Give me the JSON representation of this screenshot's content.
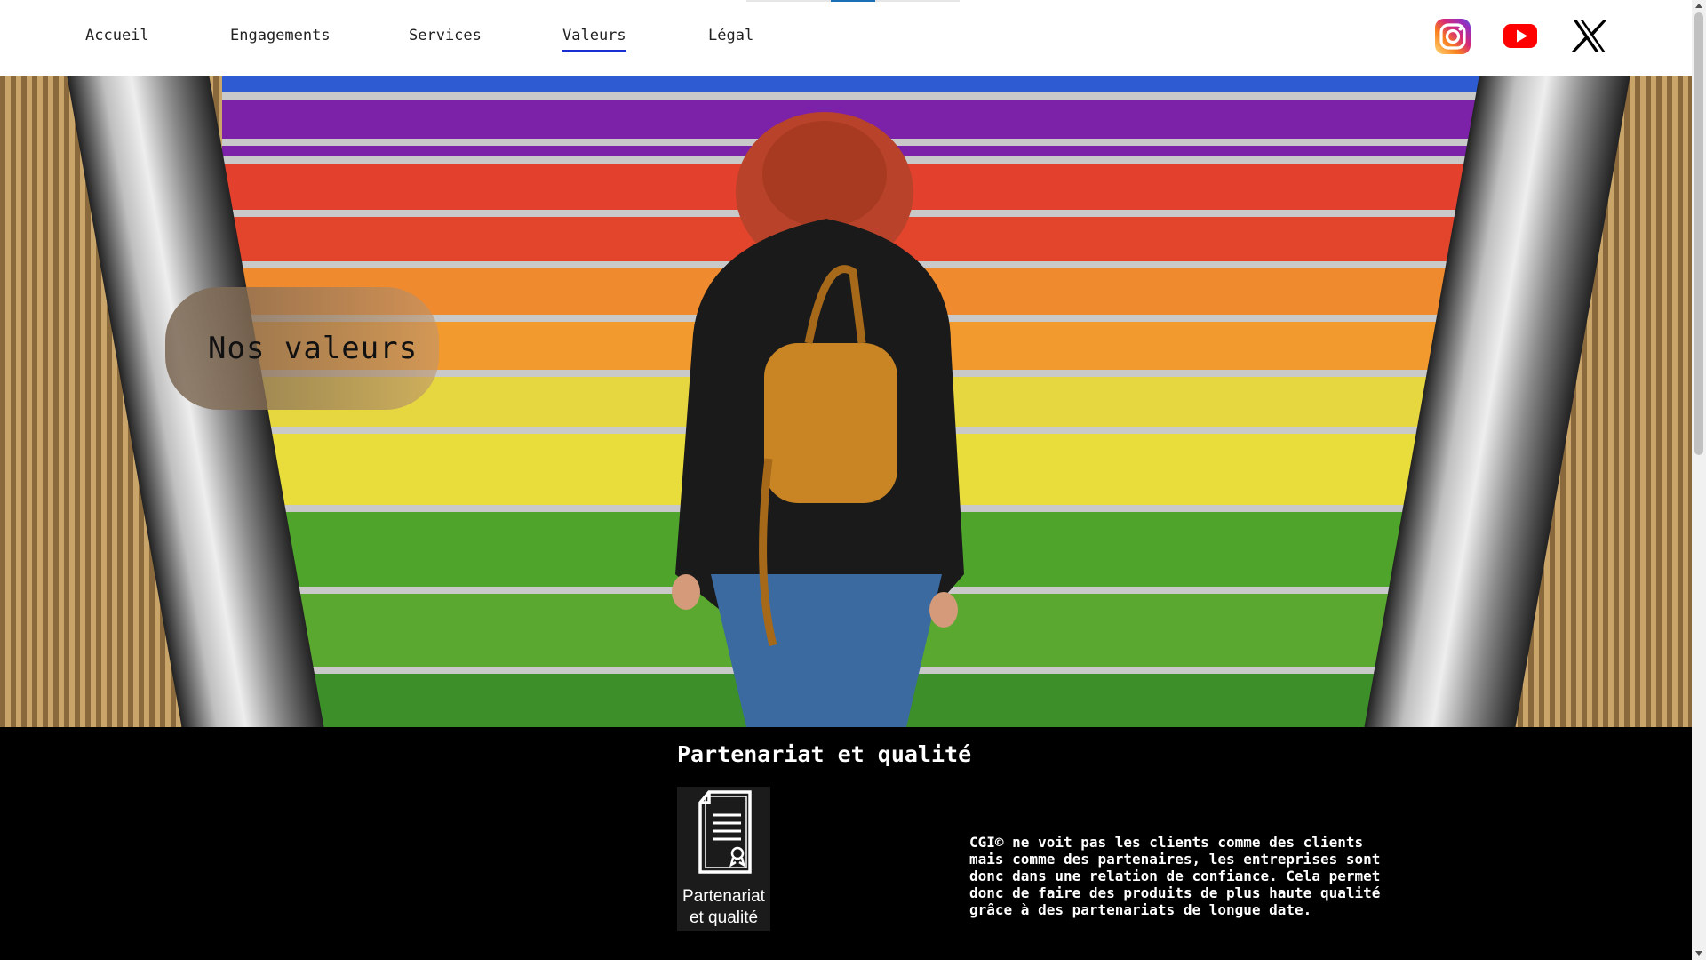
{
  "nav": {
    "items": [
      {
        "label": "Accueil",
        "active": false
      },
      {
        "label": "Engagements",
        "active": false
      },
      {
        "label": "Services",
        "active": false
      },
      {
        "label": "Valeurs",
        "active": true
      },
      {
        "label": "Légal",
        "active": false
      }
    ],
    "social": [
      "instagram-icon",
      "youtube-icon",
      "x-icon"
    ],
    "accent_color": "#1a2fd1"
  },
  "hero": {
    "title": "Nos valeurs"
  },
  "section": {
    "title": "Partenariat et qualité",
    "card": {
      "icon": "certificate-icon",
      "label_line1": "Partenariat",
      "label_line2": "et qualité"
    },
    "paragraph": "CGI© ne voit pas les clients comme des clients mais comme des partenaires, les entreprises sont donc dans une relation de confiance. Cela permet donc de faire des produits de plus haute qualité grâce à des partenariats de longue date."
  }
}
